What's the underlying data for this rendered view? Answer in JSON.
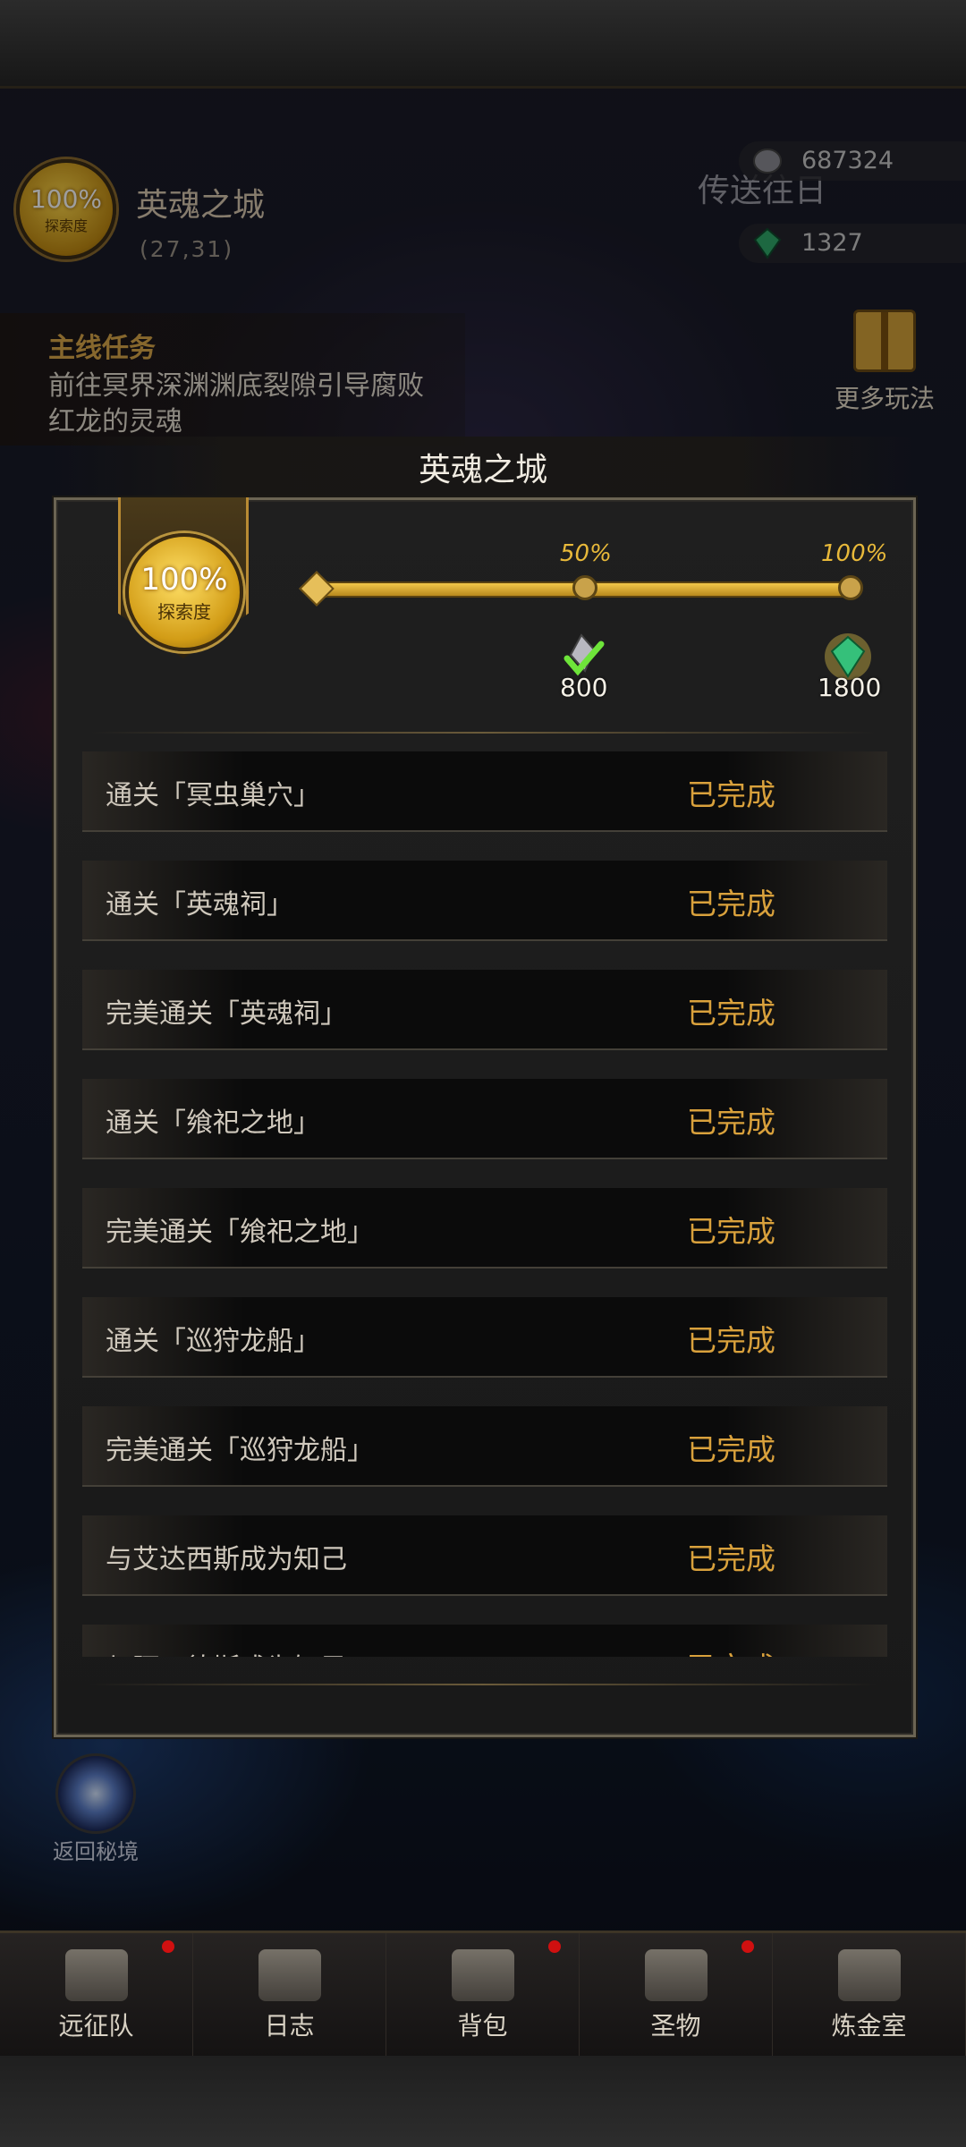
{
  "hud": {
    "explore_pct": "100%",
    "explore_label": "探索度",
    "city_name": "英魂之城",
    "coords": "(27,31)",
    "teleport_label": "传送往日",
    "currency_silver": "687324",
    "currency_gem": "1327",
    "more_play_label": "更多玩法",
    "portal_label": "返回秘境"
  },
  "quest": {
    "title": "主线任务",
    "description": "前往冥界深渊渊底裂隙引导腐败红龙的灵魂"
  },
  "popup": {
    "title": "英魂之城",
    "badge_pct": "100%",
    "badge_label": "探索度",
    "milestones": [
      {
        "pct_label": "50%",
        "reward": "800",
        "reward_icon": "silver-check-icon"
      },
      {
        "pct_label": "100%",
        "reward": "1800",
        "reward_icon": "green-gem-icon"
      }
    ],
    "progress": 1.0,
    "tasks": [
      {
        "name": "通关「冥虫巢穴」",
        "status": "已完成"
      },
      {
        "name": "通关「英魂祠」",
        "status": "已完成"
      },
      {
        "name": "完美通关「英魂祠」",
        "status": "已完成"
      },
      {
        "name": "通关「飨祀之地」",
        "status": "已完成"
      },
      {
        "name": "完美通关「飨祀之地」",
        "status": "已完成"
      },
      {
        "name": "通关「巡狩龙船」",
        "status": "已完成"
      },
      {
        "name": "完美通关「巡狩龙船」",
        "status": "已完成"
      },
      {
        "name": "与艾达西斯成为知己",
        "status": "已完成"
      },
      {
        "name": "与阿四德斯成为知己",
        "status": "已完成"
      }
    ]
  },
  "nav": [
    {
      "label": "远征队",
      "icon": "helmet-icon",
      "badge": true
    },
    {
      "label": "日志",
      "icon": "scroll-icon",
      "badge": false
    },
    {
      "label": "背包",
      "icon": "bag-icon",
      "badge": true
    },
    {
      "label": "圣物",
      "icon": "relic-icon",
      "badge": true
    },
    {
      "label": "炼金室",
      "icon": "alchemy-icon",
      "badge": false
    }
  ],
  "colors": {
    "accent_gold": "#d9a13c",
    "badge_red": "#d01010"
  }
}
